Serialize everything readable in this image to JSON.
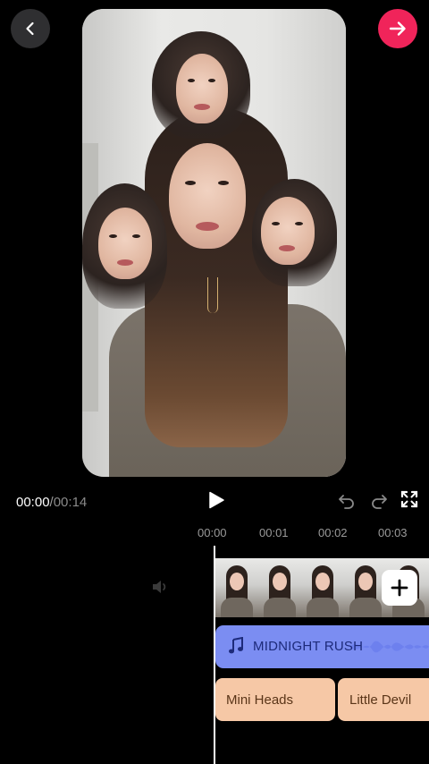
{
  "player": {
    "current_time": "00:00",
    "separator": "/",
    "duration": "00:14"
  },
  "ruler": {
    "ticks": [
      "00:00",
      "00:01",
      "00:02",
      "00:03"
    ]
  },
  "tracks": {
    "music": {
      "title": "MIDNIGHT RUSH",
      "icon": "music-note-icon"
    },
    "effects": [
      {
        "label": "Mini Heads"
      },
      {
        "label": "Little Devil"
      }
    ]
  },
  "colors": {
    "accent": "#f0245a",
    "music_track": "#7b8df2",
    "effect_track": "#f6c8a6"
  }
}
